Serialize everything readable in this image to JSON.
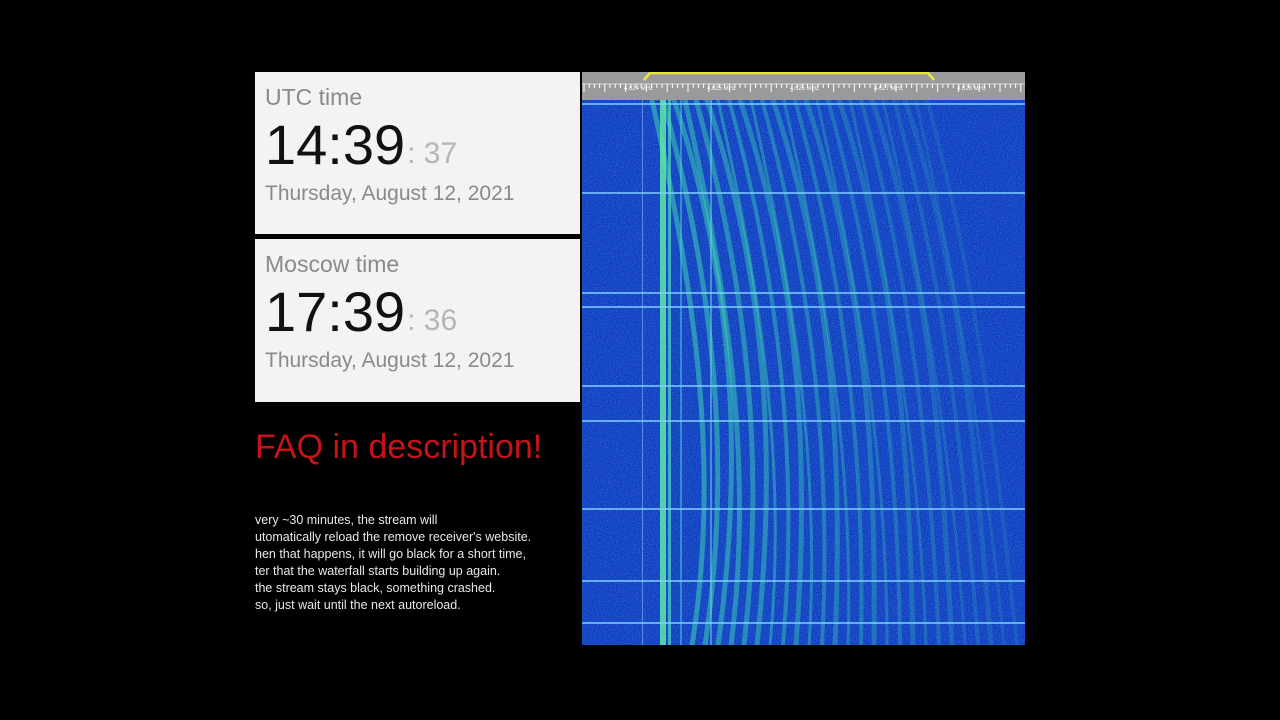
{
  "utc": {
    "label": "UTC time",
    "hm": "14:39",
    "seconds": ": 37",
    "date": "Thursday, August 12, 2021"
  },
  "moscow": {
    "label": "Moscow time",
    "hm": "17:39",
    "seconds": ": 36",
    "date": "Thursday, August 12, 2021"
  },
  "faq": {
    "heading": "FAQ in description!",
    "lines": [
      "very ~30 minutes, the stream will",
      "utomatically reload the remove receiver's website.",
      "hen that happens, it will go black for a short time,",
      "ter that the waterfall starts building up again.",
      " the stream stays black, something crashed.",
      "so, just wait until the next autoreload."
    ]
  },
  "waterfall": {
    "freq_labels": [
      "4.624 MHz",
      "4.625 MHz",
      "4.626 MHz",
      "4.627 MHz",
      "4.628 MHz"
    ],
    "colors": {
      "background": "#1036b8",
      "signal": "#3fe0b0",
      "passband": "#e8e83a"
    }
  }
}
